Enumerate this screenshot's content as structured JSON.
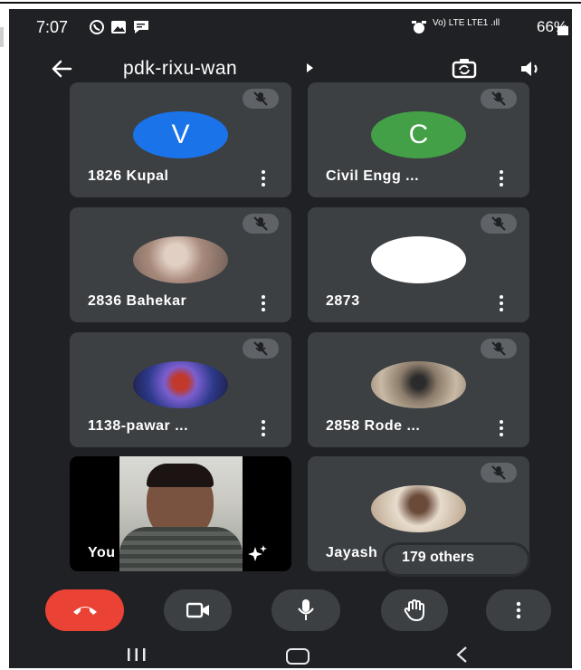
{
  "status_bar": {
    "time": "7:07",
    "right_text": "Vo) LTE LTE1 .ıll",
    "battery": "66%"
  },
  "header": {
    "meeting_title": "pdk-rixu-wan"
  },
  "participants": [
    {
      "name": "1826 Kupal",
      "initial": "V",
      "avatar_color": "#1a73e8",
      "muted": true
    },
    {
      "name": "Civil Engg ...",
      "initial": "C",
      "avatar_color": "#43a047",
      "muted": true
    },
    {
      "name": "2836 Bahekar",
      "initial": "",
      "avatar_color": "#b79f8f",
      "muted": true
    },
    {
      "name": "2873",
      "initial": "",
      "avatar_color": "#ffffff",
      "muted": true
    },
    {
      "name": "1138-pawar ...",
      "initial": "",
      "avatar_color": "#5a4cb0",
      "muted": true
    },
    {
      "name": "2858 Rode ...",
      "initial": "",
      "avatar_color": "#a7988a",
      "muted": true
    }
  ],
  "self_tile": {
    "name": "You"
  },
  "others_tile": {
    "name": "Jayash",
    "avatar_color": "#d6c3a6",
    "others_label": "179 others"
  },
  "controls": {
    "colors": {
      "end_call": "#ea4335",
      "button_bg": "#3c4043"
    }
  }
}
